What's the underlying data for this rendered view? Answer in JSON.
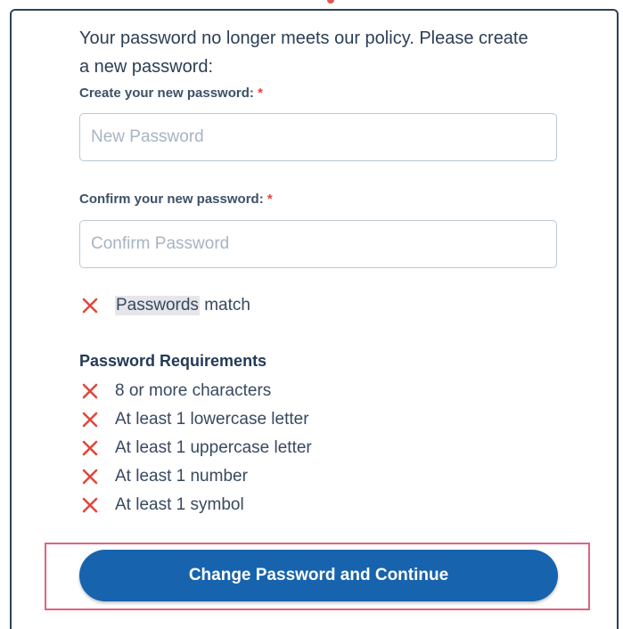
{
  "form": {
    "intro_text": "Your password no longer meets our policy. Please create a new password:",
    "new_password_label": "Create your new password:",
    "confirm_password_label": "Confirm your new password:",
    "required_marker": "*",
    "new_password_value": "",
    "new_password_placeholder": "New Password",
    "confirm_password_value": "",
    "confirm_password_placeholder": "Confirm Password"
  },
  "match_check": {
    "icon": "x-icon",
    "status": "unmet",
    "word_highlighted": "Passwords",
    "rest": " match"
  },
  "requirements": {
    "heading": "Password Requirements",
    "items": [
      {
        "label": "8 or more characters",
        "status": "unmet",
        "icon": "x-icon"
      },
      {
        "label": "At least 1 lowercase letter",
        "status": "unmet",
        "icon": "x-icon"
      },
      {
        "label": "At least 1 uppercase letter",
        "status": "unmet",
        "icon": "x-icon"
      },
      {
        "label": "At least 1 number",
        "status": "unmet",
        "icon": "x-icon"
      },
      {
        "label": "At least 1 symbol",
        "status": "unmet",
        "icon": "x-icon"
      }
    ]
  },
  "actions": {
    "submit_label": "Change Password and Continue"
  },
  "colors": {
    "primary_button": "#1763ae",
    "error_icon": "#e0473e",
    "focus_outline": "#e0627f",
    "card_border": "#2e4157"
  }
}
